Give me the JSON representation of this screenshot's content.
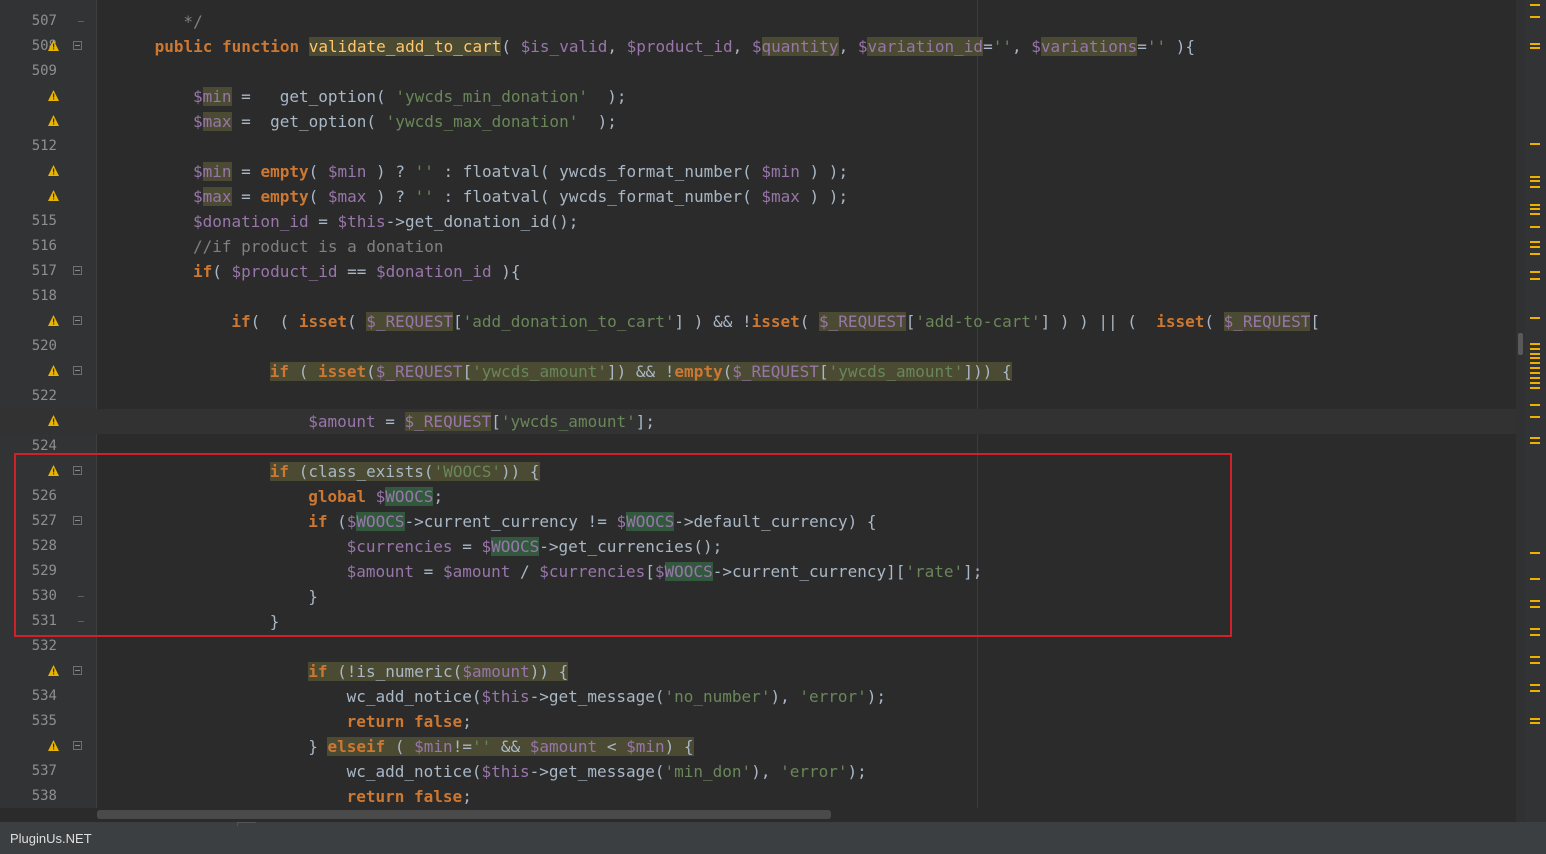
{
  "editor": {
    "lines": [
      {
        "n": "507",
        "warn": false,
        "fold": "end",
        "indent": "        ",
        "tokens": [
          [
            "c",
            " */"
          ]
        ]
      },
      {
        "n": "508",
        "warn": true,
        "fold": "open",
        "indent": "      ",
        "tokens": [
          [
            "k",
            "public function"
          ],
          [
            "p",
            " "
          ],
          [
            "f hl",
            "validate_add_to_cart"
          ],
          [
            "p",
            "( "
          ],
          [
            "v",
            "$is_valid"
          ],
          [
            "p",
            ", "
          ],
          [
            "v",
            "$product_id"
          ],
          [
            "p",
            ", "
          ],
          [
            "v",
            "$"
          ],
          [
            "v hl",
            "quantity"
          ],
          [
            "p",
            ", "
          ],
          [
            "v",
            "$"
          ],
          [
            "v hl",
            "variation_id"
          ],
          [
            "p",
            "="
          ],
          [
            "s",
            "''"
          ],
          [
            "p",
            ", "
          ],
          [
            "v",
            "$"
          ],
          [
            "v hl",
            "variations"
          ],
          [
            "p",
            "="
          ],
          [
            "s",
            "''"
          ],
          [
            "p",
            " ){"
          ]
        ]
      },
      {
        "n": "509",
        "warn": false,
        "fold": "",
        "indent": "",
        "tokens": []
      },
      {
        "n": "",
        "warn": true,
        "fold": "",
        "indent": "          ",
        "tokens": [
          [
            "v",
            "$"
          ],
          [
            "v hl",
            "min"
          ],
          [
            "p",
            " =   get_option( "
          ],
          [
            "s",
            "'ywcds_min_donation'"
          ],
          [
            "p",
            "  );"
          ]
        ]
      },
      {
        "n": "",
        "warn": true,
        "fold": "",
        "indent": "          ",
        "tokens": [
          [
            "v",
            "$"
          ],
          [
            "v hl",
            "max"
          ],
          [
            "p",
            " =  get_option( "
          ],
          [
            "s",
            "'ywcds_max_donation'"
          ],
          [
            "p",
            "  );"
          ]
        ]
      },
      {
        "n": "512",
        "warn": false,
        "fold": "",
        "indent": "",
        "tokens": []
      },
      {
        "n": "",
        "warn": true,
        "fold": "",
        "indent": "          ",
        "tokens": [
          [
            "v",
            "$"
          ],
          [
            "v hl",
            "min"
          ],
          [
            "p",
            " = "
          ],
          [
            "k",
            "empty"
          ],
          [
            "p",
            "( "
          ],
          [
            "v",
            "$min"
          ],
          [
            "p",
            " ) ? "
          ],
          [
            "s",
            "''"
          ],
          [
            "p",
            " : floatval( ywcds_format_number( "
          ],
          [
            "v",
            "$min"
          ],
          [
            "p",
            " ) );"
          ]
        ]
      },
      {
        "n": "",
        "warn": true,
        "fold": "",
        "indent": "          ",
        "tokens": [
          [
            "v",
            "$"
          ],
          [
            "v hl",
            "max"
          ],
          [
            "p",
            " = "
          ],
          [
            "k",
            "empty"
          ],
          [
            "p",
            "( "
          ],
          [
            "v",
            "$max"
          ],
          [
            "p",
            " ) ? "
          ],
          [
            "s",
            "''"
          ],
          [
            "p",
            " : floatval( ywcds_format_number( "
          ],
          [
            "v",
            "$max"
          ],
          [
            "p",
            " ) );"
          ]
        ]
      },
      {
        "n": "515",
        "warn": false,
        "fold": "",
        "indent": "          ",
        "tokens": [
          [
            "v",
            "$donation_id"
          ],
          [
            "p",
            " = "
          ],
          [
            "v",
            "$this"
          ],
          [
            "p",
            "->get_donation_id();"
          ]
        ]
      },
      {
        "n": "516",
        "warn": false,
        "fold": "",
        "indent": "          ",
        "tokens": [
          [
            "c",
            "//if product is a donation"
          ]
        ]
      },
      {
        "n": "517",
        "warn": false,
        "fold": "open",
        "indent": "          ",
        "tokens": [
          [
            "k",
            "if"
          ],
          [
            "p",
            "( "
          ],
          [
            "v",
            "$product_id"
          ],
          [
            "p",
            " == "
          ],
          [
            "v",
            "$donation_id"
          ],
          [
            "p",
            " ){"
          ]
        ]
      },
      {
        "n": "518",
        "warn": false,
        "fold": "",
        "indent": "",
        "tokens": []
      },
      {
        "n": "",
        "warn": true,
        "fold": "open",
        "indent": "              ",
        "tokens": [
          [
            "k",
            "if"
          ],
          [
            "p",
            "(  ( "
          ],
          [
            "k",
            "isset"
          ],
          [
            "p",
            "( "
          ],
          [
            "v hl",
            "$_REQUEST"
          ],
          [
            "p",
            "["
          ],
          [
            "s",
            "'add_donation_to_cart'"
          ],
          [
            "p",
            "] ) && !"
          ],
          [
            "k",
            "isset"
          ],
          [
            "p",
            "( "
          ],
          [
            "v hl",
            "$_REQUEST"
          ],
          [
            "p",
            "["
          ],
          [
            "s",
            "'add-to-cart'"
          ],
          [
            "p",
            "] ) ) || (  "
          ],
          [
            "k",
            "isset"
          ],
          [
            "p",
            "( "
          ],
          [
            "v hl",
            "$_REQUEST"
          ],
          [
            "p",
            "["
          ]
        ]
      },
      {
        "n": "520",
        "warn": false,
        "fold": "",
        "indent": "",
        "tokens": []
      },
      {
        "n": "",
        "warn": true,
        "fold": "open",
        "indent": "                  ",
        "tokens": [
          [
            "k hl",
            "if"
          ],
          [
            "p hl",
            " ( "
          ],
          [
            "k hl",
            "isset"
          ],
          [
            "p hl",
            "("
          ],
          [
            "v hl",
            "$_REQUEST"
          ],
          [
            "p hl",
            "["
          ],
          [
            "s hl",
            "'ywcds_amount'"
          ],
          [
            "p hl",
            "]) && !"
          ],
          [
            "k hl",
            "empty"
          ],
          [
            "p hl",
            "("
          ],
          [
            "v hl",
            "$_REQUEST"
          ],
          [
            "p hl",
            "["
          ],
          [
            "s hl",
            "'ywcds_amount'"
          ],
          [
            "p hl",
            "])) {"
          ]
        ]
      },
      {
        "n": "522",
        "warn": false,
        "fold": "",
        "indent": "",
        "tokens": []
      },
      {
        "n": "",
        "warn": true,
        "fold": "",
        "indent": "                      ",
        "tokens": [
          [
            "v",
            "$amount"
          ],
          [
            "p",
            " = "
          ],
          [
            "v hl",
            "$_REQUEST"
          ],
          [
            "p",
            "["
          ],
          [
            "s",
            "'ywcds_amount'"
          ],
          [
            "p",
            "];"
          ]
        ]
      },
      {
        "n": "524",
        "warn": false,
        "fold": "",
        "indent": "",
        "tokens": []
      },
      {
        "n": "",
        "warn": true,
        "fold": "open",
        "indent": "                  ",
        "tokens": [
          [
            "k hl",
            "if"
          ],
          [
            "p hl",
            " (class_exists("
          ],
          [
            "s hl",
            "'WOOCS'"
          ],
          [
            "p hl",
            ")) {"
          ]
        ]
      },
      {
        "n": "526",
        "warn": false,
        "fold": "",
        "indent": "                      ",
        "tokens": [
          [
            "k",
            "global"
          ],
          [
            "p",
            " "
          ],
          [
            "v",
            "$"
          ],
          [
            "v hw",
            "WOOCS"
          ],
          [
            "p",
            ";"
          ]
        ]
      },
      {
        "n": "527",
        "warn": false,
        "fold": "open",
        "indent": "                      ",
        "tokens": [
          [
            "k",
            "if"
          ],
          [
            "p",
            " ("
          ],
          [
            "v",
            "$"
          ],
          [
            "v hw",
            "WOOCS"
          ],
          [
            "p",
            "->current_currency != "
          ],
          [
            "v",
            "$"
          ],
          [
            "v hw",
            "WOOCS"
          ],
          [
            "p",
            "->default_currency) {"
          ]
        ]
      },
      {
        "n": "528",
        "warn": false,
        "fold": "",
        "indent": "                          ",
        "tokens": [
          [
            "v",
            "$currencies"
          ],
          [
            "p",
            " = "
          ],
          [
            "v",
            "$"
          ],
          [
            "v hw",
            "WOOCS"
          ],
          [
            "p",
            "->get_currencies();"
          ]
        ]
      },
      {
        "n": "529",
        "warn": false,
        "fold": "",
        "indent": "                          ",
        "tokens": [
          [
            "v",
            "$amount"
          ],
          [
            "p",
            " = "
          ],
          [
            "v",
            "$amount"
          ],
          [
            "p",
            " / "
          ],
          [
            "v",
            "$currencies"
          ],
          [
            "p",
            "["
          ],
          [
            "v",
            "$"
          ],
          [
            "v hw",
            "WOOCS"
          ],
          [
            "p",
            "->current_currency]["
          ],
          [
            "s",
            "'rate'"
          ],
          [
            "p",
            "];"
          ]
        ]
      },
      {
        "n": "530",
        "warn": false,
        "fold": "end",
        "indent": "                      ",
        "tokens": [
          [
            "p",
            "}"
          ]
        ]
      },
      {
        "n": "531",
        "warn": false,
        "fold": "end",
        "indent": "                  ",
        "tokens": [
          [
            "p",
            "}"
          ]
        ]
      },
      {
        "n": "532",
        "warn": false,
        "fold": "",
        "indent": "",
        "tokens": []
      },
      {
        "n": "",
        "warn": true,
        "fold": "open",
        "indent": "                      ",
        "tokens": [
          [
            "k hl",
            "if"
          ],
          [
            "p hl",
            " (!is_numeric("
          ],
          [
            "v hl",
            "$amount"
          ],
          [
            "p hl",
            ")) {"
          ]
        ]
      },
      {
        "n": "534",
        "warn": false,
        "fold": "",
        "indent": "                          ",
        "tokens": [
          [
            "p",
            "wc_add_notice("
          ],
          [
            "v",
            "$this"
          ],
          [
            "p",
            "->get_message("
          ],
          [
            "s",
            "'no_number'"
          ],
          [
            "p",
            "), "
          ],
          [
            "s",
            "'error'"
          ],
          [
            "p",
            ");"
          ]
        ]
      },
      {
        "n": "535",
        "warn": false,
        "fold": "",
        "indent": "                          ",
        "tokens": [
          [
            "k",
            "return false"
          ],
          [
            "p",
            ";"
          ]
        ]
      },
      {
        "n": "",
        "warn": true,
        "fold": "open",
        "indent": "                      ",
        "tokens": [
          [
            "p",
            "} "
          ],
          [
            "k hl",
            "elseif"
          ],
          [
            "p hl",
            " ( "
          ],
          [
            "v hl",
            "$min"
          ],
          [
            "p hl",
            "!="
          ],
          [
            "s hl",
            "''"
          ],
          [
            "p hl",
            " && "
          ],
          [
            "v hl",
            "$amount"
          ],
          [
            "p hl",
            " < "
          ],
          [
            "v hl",
            "$min"
          ],
          [
            "p hl",
            ") {"
          ]
        ]
      },
      {
        "n": "537",
        "warn": false,
        "fold": "",
        "indent": "                          ",
        "tokens": [
          [
            "p",
            "wc_add_notice("
          ],
          [
            "v",
            "$this"
          ],
          [
            "p",
            "->get_message("
          ],
          [
            "s",
            "'min_don'"
          ],
          [
            "p",
            "), "
          ],
          [
            "s",
            "'error'"
          ],
          [
            "p",
            ");"
          ]
        ]
      },
      {
        "n": "538",
        "warn": false,
        "fold": "",
        "indent": "                          ",
        "tokens": [
          [
            "k",
            "return false"
          ],
          [
            "p",
            ";"
          ]
        ]
      }
    ]
  },
  "watermark": "PluginUs.NET",
  "colors": {
    "background": "#2b2b2b",
    "keyword": "#cc7832",
    "variable": "#9876aa",
    "string": "#6a8759",
    "highlight_box": "#d0202a",
    "warning": "#f0b000"
  }
}
